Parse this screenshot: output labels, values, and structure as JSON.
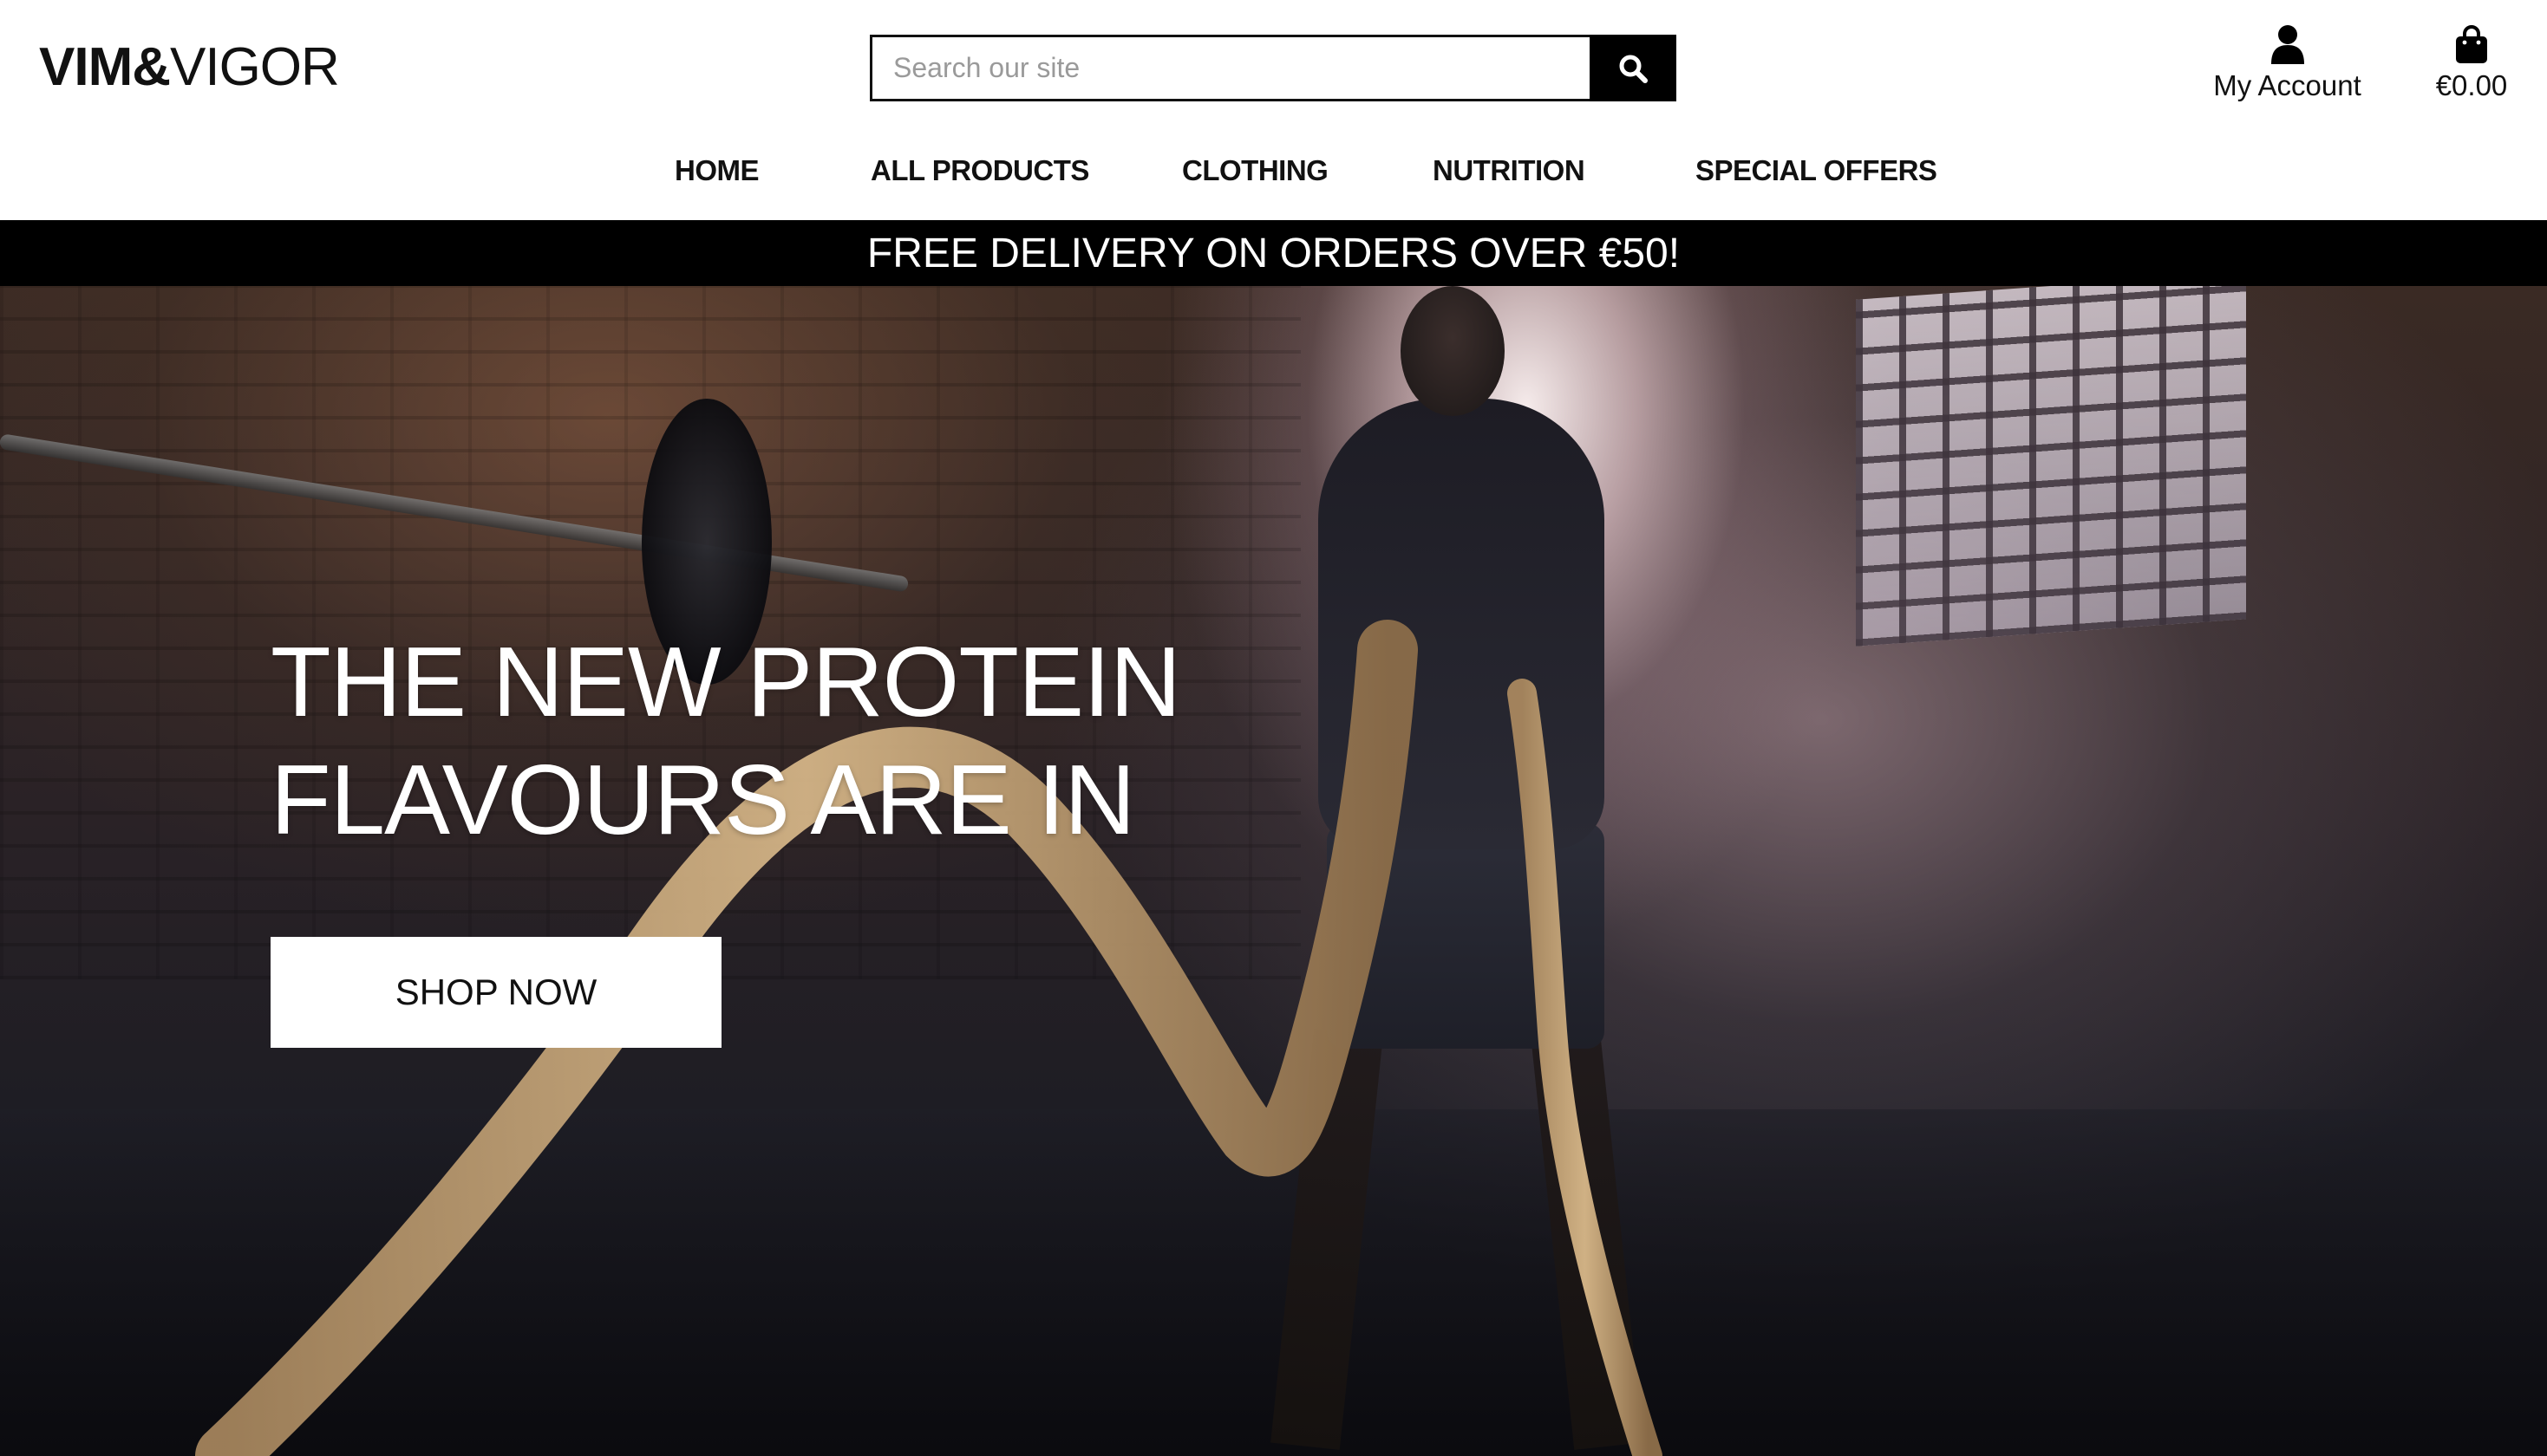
{
  "brand": {
    "logo_bold": "VIM&",
    "logo_light": "VIGOR"
  },
  "search": {
    "placeholder": "Search our site",
    "value": "",
    "button_icon": "search-icon"
  },
  "account": {
    "label": "My Account",
    "icon": "user-icon"
  },
  "cart": {
    "total": "€0.00",
    "icon": "shopping-bag-icon"
  },
  "nav": {
    "items": [
      {
        "label": "HOME"
      },
      {
        "label": "ALL PRODUCTS"
      },
      {
        "label": "CLOTHING"
      },
      {
        "label": "NUTRITION"
      },
      {
        "label": "SPECIAL OFFERS"
      }
    ]
  },
  "banner": {
    "text": "FREE DELIVERY ON ORDERS OVER €50!"
  },
  "hero": {
    "heading_line1": "THE NEW PROTEIN",
    "heading_line2": "FLAVOURS ARE IN",
    "cta_label": "SHOP NOW"
  },
  "colors": {
    "banner_bg": "#000000",
    "banner_text": "#ffffff",
    "cta_bg": "#ffffff",
    "text_primary": "#111111"
  }
}
